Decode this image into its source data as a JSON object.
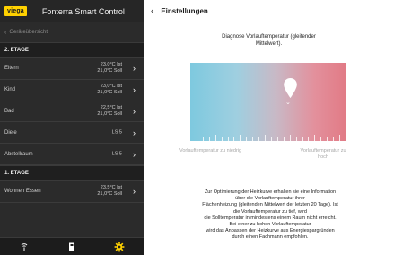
{
  "sidebar": {
    "logo": "viega",
    "app_title": "Fonterra Smart Control",
    "back_label": "Geräteübersicht",
    "section_2": "2. ETAGE",
    "rooms_2": [
      {
        "name": "Eltern",
        "ist": "23,0°C Ist",
        "soll": "21,0°C Soll"
      },
      {
        "name": "Kind",
        "ist": "23,0°C Ist",
        "soll": "21,0°C Soll"
      },
      {
        "name": "Bad",
        "ist": "22,5°C Ist",
        "soll": "21,0°C Soll"
      },
      {
        "name": "Diele",
        "ist": "LS 5",
        "soll": ""
      },
      {
        "name": "Abstellraum",
        "ist": "LS 5",
        "soll": ""
      }
    ],
    "section_1": "1. ETAGE",
    "rooms_1": [
      {
        "name": "Wohnen Essen",
        "ist": "23,5°C Ist",
        "soll": "21,0°C Soll"
      }
    ],
    "nav_icons": [
      "signal-icon",
      "device-icon",
      "gear-icon"
    ],
    "active_color": "#ffd100"
  },
  "main": {
    "header_title": "Einstellungen",
    "diag_line1": "Diagnose Vorlauftemperatur (gleitender",
    "diag_line2": "Mittelwert).",
    "range_left": "Vorlauftemperatur zu niedrig",
    "range_right_1": "Vorlauftemperatur zu",
    "range_right_2": "hoch",
    "marker_level": 0.6,
    "info_lines": [
      "Zur Optimierung der Heizkurve erhalten sie eine Information",
      "über die Vorlauftemperatur ihrer",
      "Flächenheizung (gleitenden Mittelwert der letzten 20 Tage). Ist",
      "die Vorlauftemperatur zu tief, wird",
      "die Solltemperatur in mindestens einem Raum nicht erreicht.",
      "Bei einer zu hohen Vorlauftemperatur",
      "wird das Anpassen der Heizkurve aus Energiespargründen",
      "durch einen Fachmann empfohlen."
    ]
  }
}
